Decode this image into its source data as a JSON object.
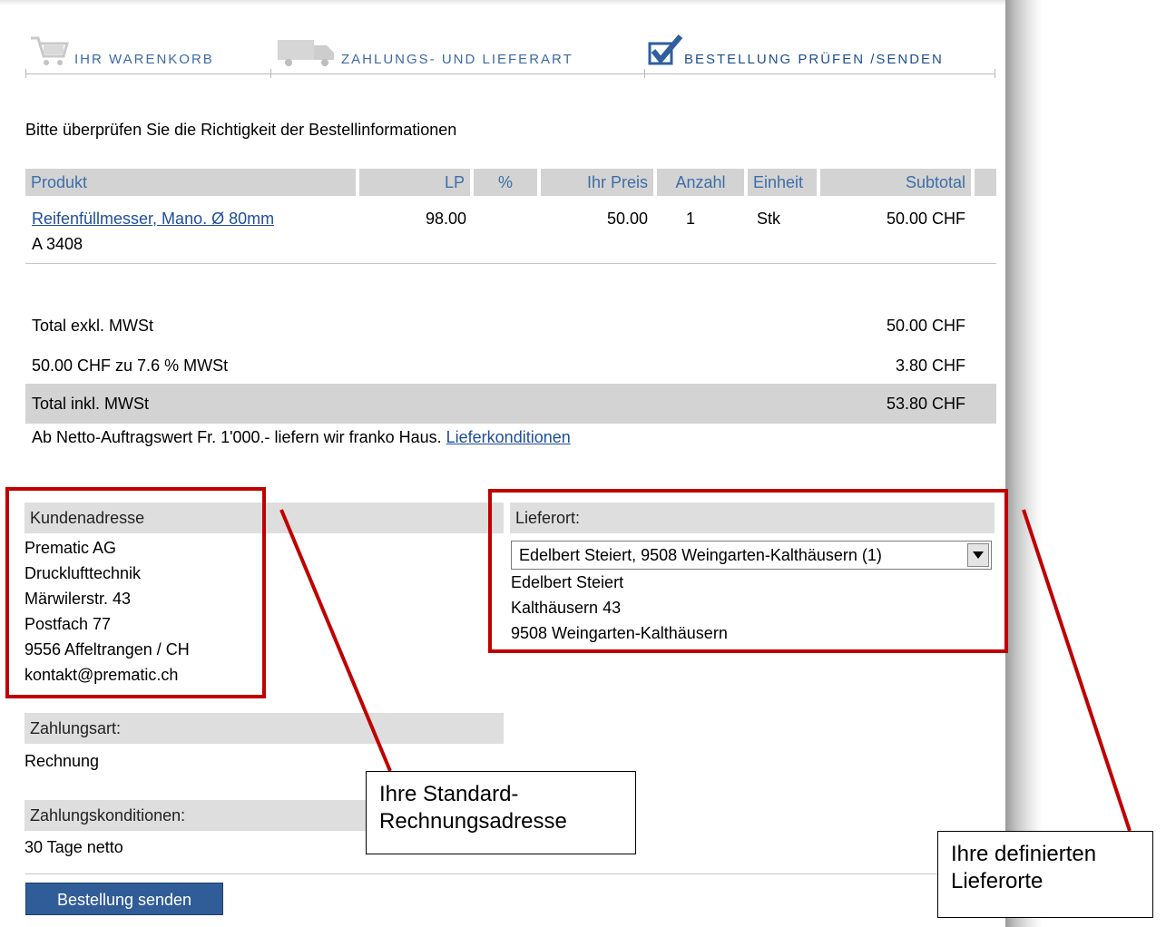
{
  "steps": [
    {
      "label": "IHR WARENKORB",
      "icon": "cart-icon"
    },
    {
      "label": "ZAHLUNGS- UND LIEFERART",
      "icon": "truck-icon"
    },
    {
      "label": "BESTELLUNG PRÜFEN /SENDEN",
      "icon": "checkmark-icon"
    }
  ],
  "intro": "Bitte überprüfen Sie die Richtigkeit der Bestellinformationen",
  "table": {
    "headers": [
      "Produkt",
      "LP",
      "%",
      "Ihr Preis",
      "Anzahl",
      "Einheit",
      "Subtotal"
    ],
    "rows": [
      {
        "product": "Reifenfüllmesser, Mano. Ø 80mm",
        "article": "A 3408",
        "lp": "98.00",
        "pct": "",
        "price": "50.00",
        "qty": "1",
        "unit": "Stk",
        "subtotal": "50.00 CHF"
      }
    ]
  },
  "totals": {
    "excl_label": "Total exkl. MWSt",
    "excl_value": "50.00 CHF",
    "vat_label": "50.00 CHF zu 7.6 % MWSt",
    "vat_value": "3.80 CHF",
    "incl_label": "Total inkl. MWSt",
    "incl_value": "53.80 CHF"
  },
  "shipping_note": {
    "text": "Ab Netto-Auftragswert Fr. 1'000.- liefern wir franko Haus.",
    "link": "Lieferkonditionen"
  },
  "customer": {
    "heading": "Kundenadresse",
    "lines": [
      "Prematic AG",
      "Drucklufttechnik",
      "Märwilerstr. 43",
      "Postfach 77",
      "9556 Affeltrangen / CH",
      "kontakt@prematic.ch"
    ]
  },
  "delivery": {
    "heading": "Lieferort:",
    "selected": "Edelbert Steiert, 9508 Weingarten-Kalthäusern (1)",
    "lines": [
      "Edelbert Steiert",
      "Kalthäusern 43",
      "9508 Weingarten-Kalthäusern"
    ]
  },
  "payment": {
    "heading": "Zahlungsart:",
    "value": "Rechnung"
  },
  "terms": {
    "heading": "Zahlungskonditionen:",
    "value": "30 Tage netto"
  },
  "send_button": "Bestellung senden",
  "callouts": {
    "billing": [
      "Ihre Standard-",
      "Rechnungsadresse"
    ],
    "delivery": [
      "Ihre definierten",
      "Lieferorte"
    ]
  },
  "colors": {
    "accent": "#305c98",
    "link": "#1f4e99",
    "header_text": "#3d6ea8",
    "annotation": "#c00000"
  }
}
